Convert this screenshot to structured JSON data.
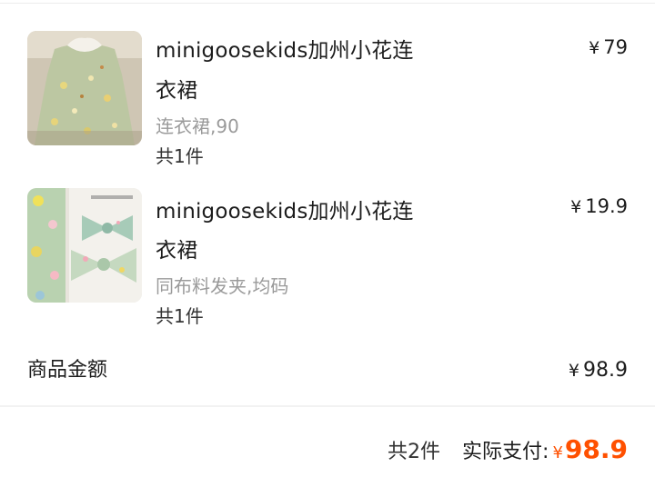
{
  "items": [
    {
      "title_line1": "minigoosekids加州小花连",
      "title_line2": "衣裙",
      "spec": "连衣裙,90",
      "quantity": "共1件",
      "currency": "¥",
      "price": "79",
      "image_icon": "floral-dress-image"
    },
    {
      "title_line1": "minigoosekids加州小花连",
      "title_line2": "衣裙",
      "spec": "同布料发夹,均码",
      "quantity": "共1件",
      "currency": "¥",
      "price": "19.9",
      "image_icon": "floral-hair-clip-image"
    }
  ],
  "summary": {
    "goods_amount_label": "商品金额",
    "currency": "¥",
    "goods_amount": "98.9"
  },
  "footer": {
    "total_count": "共2件",
    "paid_label": "实际支付:",
    "currency": "¥",
    "paid_amount": "98.9",
    "accent_color": "#ff5000"
  }
}
